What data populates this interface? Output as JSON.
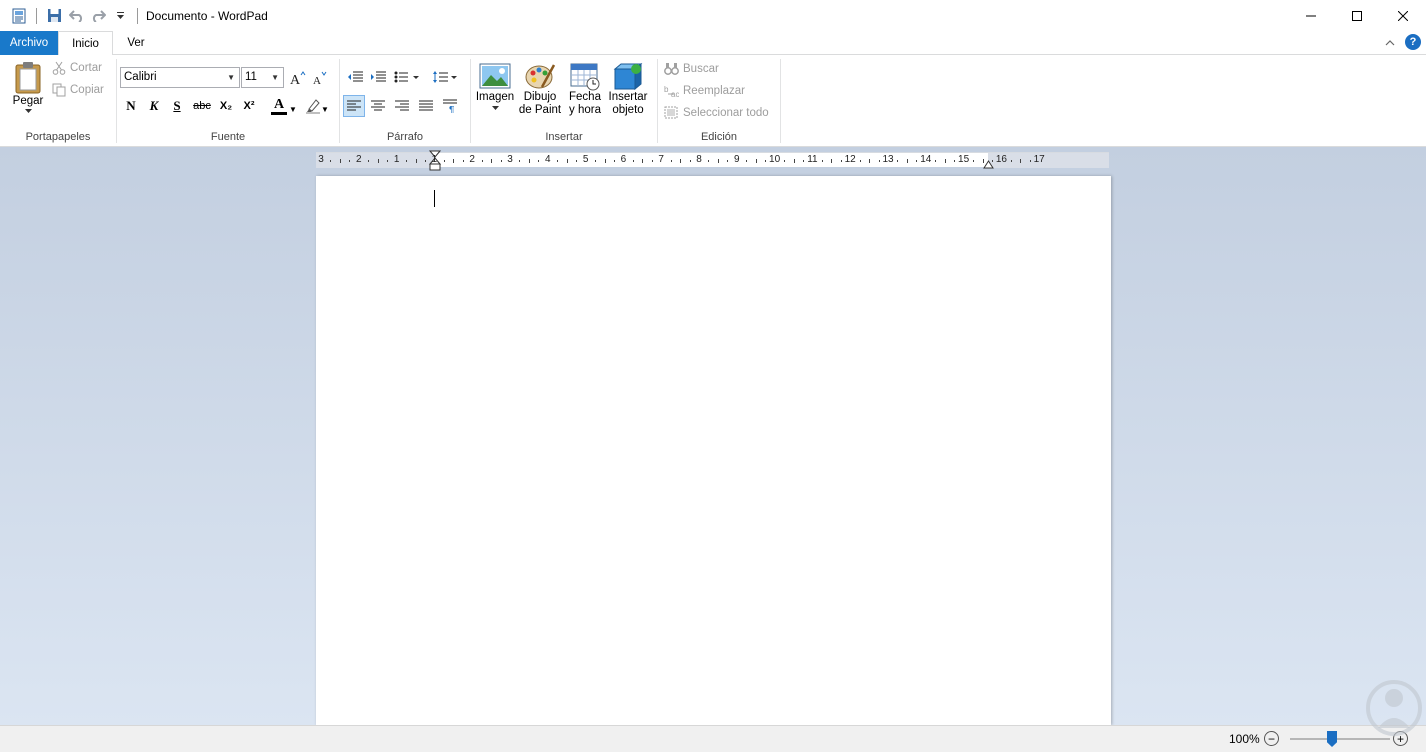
{
  "window": {
    "title": "Documento - WordPad"
  },
  "tabs": {
    "archivo": "Archivo",
    "inicio": "Inicio",
    "ver": "Ver"
  },
  "help": "?",
  "clipboard": {
    "paste": "Pegar",
    "cut": "Cortar",
    "copy": "Copiar",
    "group_label": "Portapapeles"
  },
  "font": {
    "family": "Calibri",
    "size": "11",
    "bold": "N",
    "italic": "K",
    "underline": "S",
    "strike": "abc",
    "subscript": "X₂",
    "superscript": "X²",
    "text_color_glyph": "A",
    "group_label": "Fuente"
  },
  "paragraph": {
    "group_label": "Párrafo"
  },
  "insert": {
    "image": "Imagen",
    "paint_line1": "Dibujo",
    "paint_line2": "de Paint",
    "datetime_line1": "Fecha",
    "datetime_line2": "y hora",
    "object_line1": "Insertar",
    "object_line2": "objeto",
    "group_label": "Insertar"
  },
  "editing": {
    "find": "Buscar",
    "replace": "Reemplazar",
    "select_all": "Seleccionar todo",
    "group_label": "Edición"
  },
  "ruler": {
    "labels": [
      "3",
      "2",
      "1",
      "1",
      "2",
      "3",
      "4",
      "5",
      "6",
      "7",
      "8",
      "9",
      "10",
      "11",
      "12",
      "13",
      "14",
      "15",
      "16",
      "17"
    ]
  },
  "status": {
    "zoom": "100%",
    "zoom_out": "−",
    "zoom_in": "+"
  },
  "colors": {
    "accent": "#1979ca",
    "workspace_top": "#c3cfe0",
    "workspace_bottom": "#dbe5f2"
  }
}
